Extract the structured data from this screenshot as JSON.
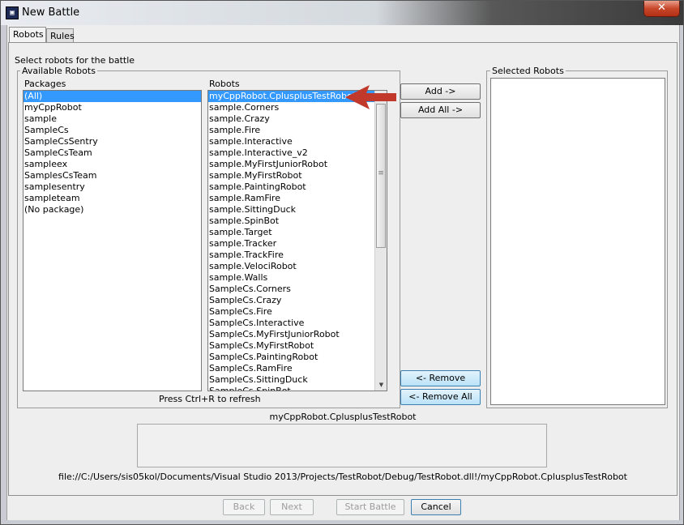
{
  "window": {
    "title": "New Battle",
    "icon_glyph": "▣",
    "close_glyph": "✕"
  },
  "tabs": [
    {
      "label": "Robots",
      "active": true
    },
    {
      "label": "Rules",
      "active": false
    }
  ],
  "panel": {
    "instruction": "Select robots for the battle",
    "available_title": "Available Robots",
    "packages_header": "Packages",
    "robots_header": "Robots",
    "selected_title": "Selected Robots",
    "refresh_hint": "Press Ctrl+R to refresh"
  },
  "packages": [
    {
      "label": "(All)",
      "selected": true
    },
    {
      "label": "myCppRobot"
    },
    {
      "label": "sample"
    },
    {
      "label": "SampleCs"
    },
    {
      "label": "SampleCsSentry"
    },
    {
      "label": "SampleCsTeam"
    },
    {
      "label": "sampleex"
    },
    {
      "label": "SamplesCsTeam"
    },
    {
      "label": "samplesentry"
    },
    {
      "label": "sampleteam"
    },
    {
      "label": "(No package)"
    }
  ],
  "robots": [
    {
      "label": "myCppRobot.CplusplusTestRobot",
      "selected": true
    },
    {
      "label": "sample.Corners"
    },
    {
      "label": "sample.Crazy"
    },
    {
      "label": "sample.Fire"
    },
    {
      "label": "sample.Interactive"
    },
    {
      "label": "sample.Interactive_v2"
    },
    {
      "label": "sample.MyFirstJuniorRobot"
    },
    {
      "label": "sample.MyFirstRobot"
    },
    {
      "label": "sample.PaintingRobot"
    },
    {
      "label": "sample.RamFire"
    },
    {
      "label": "sample.SittingDuck"
    },
    {
      "label": "sample.SpinBot"
    },
    {
      "label": "sample.Target"
    },
    {
      "label": "sample.Tracker"
    },
    {
      "label": "sample.TrackFire"
    },
    {
      "label": "sample.VelociRobot"
    },
    {
      "label": "sample.Walls"
    },
    {
      "label": "SampleCs.Corners"
    },
    {
      "label": "SampleCs.Crazy"
    },
    {
      "label": "SampleCs.Fire"
    },
    {
      "label": "SampleCs.Interactive"
    },
    {
      "label": "SampleCs.MyFirstJuniorRobot"
    },
    {
      "label": "SampleCs.MyFirstRobot"
    },
    {
      "label": "SampleCs.PaintingRobot"
    },
    {
      "label": "SampleCs.RamFire"
    },
    {
      "label": "SampleCs.SittingDuck"
    },
    {
      "label": "SampleCs.SpinBot"
    }
  ],
  "scrollbar": {
    "up": "▲",
    "down": "▼",
    "grip": "≡"
  },
  "buttons": {
    "add": "Add ->",
    "add_all": "Add All ->",
    "remove": "<- Remove",
    "remove_all": "<- Remove All",
    "back": "Back",
    "next": "Next",
    "start_battle": "Start Battle",
    "cancel": "Cancel"
  },
  "details": {
    "robot_name": "myCppRobot.CplusplusTestRobot",
    "path": "file://C:/Users/sis05kol/Documents/Visual Studio 2013/Projects/TestRobot/Debug/TestRobot.dll!/myCppRobot.CplusplusTestRobot"
  },
  "colors": {
    "selection": "#3399ff",
    "annotation_arrow": "#c0392b"
  }
}
